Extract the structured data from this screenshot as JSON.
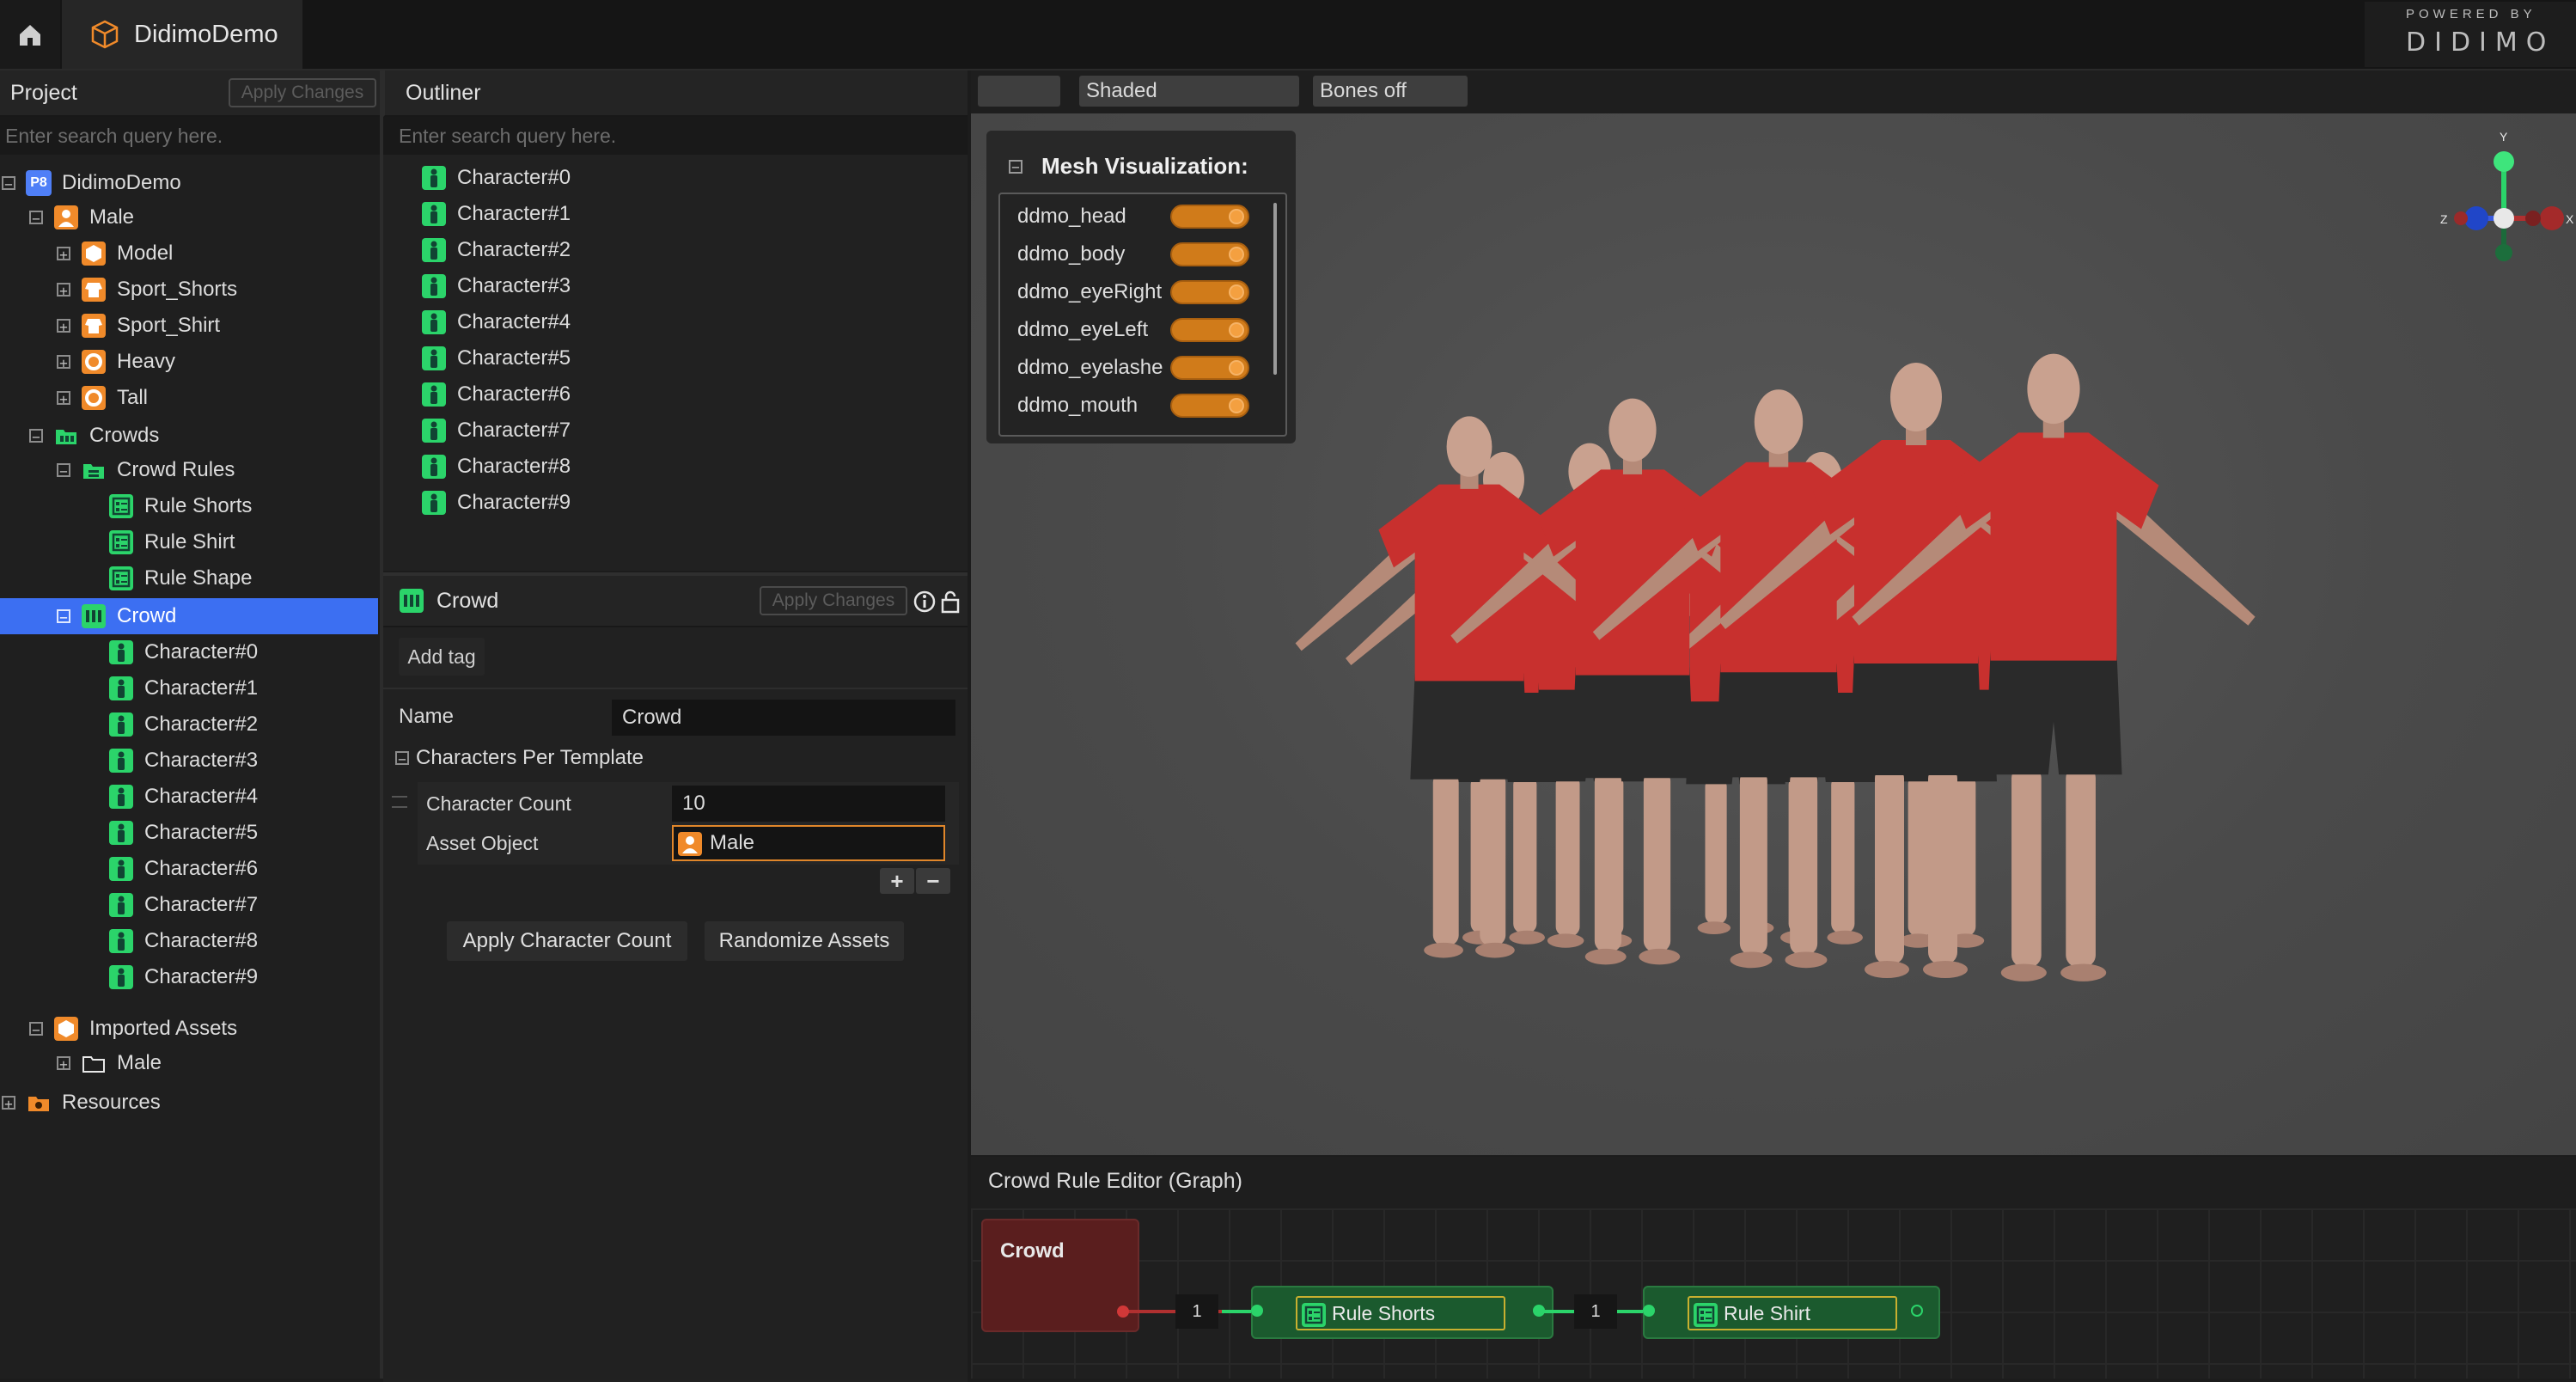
{
  "app": {
    "tab_title": "DidimoDemo",
    "powered_by": "POWERED BY",
    "brand": "DIDIMO"
  },
  "project": {
    "title": "Project",
    "apply_label": "Apply Changes",
    "search_placeholder": "Enter search query here.",
    "tree": {
      "root": "DidimoDemo",
      "root_badge": "P8",
      "male": "Male",
      "model": "Model",
      "sport_shorts": "Sport_Shorts",
      "sport_shirt": "Sport_Shirt",
      "heavy": "Heavy",
      "tall": "Tall",
      "crowds": "Crowds",
      "crowd_rules": "Crowd Rules",
      "rule_shorts": "Rule Shorts",
      "rule_shirt": "Rule Shirt",
      "rule_shape": "Rule Shape",
      "crowd": "Crowd",
      "characters": [
        "Character#0",
        "Character#1",
        "Character#2",
        "Character#3",
        "Character#4",
        "Character#5",
        "Character#6",
        "Character#7",
        "Character#8",
        "Character#9"
      ],
      "imported_assets": "Imported Assets",
      "imported_male": "Male",
      "resources": "Resources"
    }
  },
  "outliner": {
    "title": "Outliner",
    "search_placeholder": "Enter search query here.",
    "items": [
      "Character#0",
      "Character#1",
      "Character#2",
      "Character#3",
      "Character#4",
      "Character#5",
      "Character#6",
      "Character#7",
      "Character#8",
      "Character#9"
    ]
  },
  "properties": {
    "title": "Crowd",
    "apply_label": "Apply Changes",
    "add_tag": "Add tag",
    "name_label": "Name",
    "name_value": "Crowd",
    "section": "Characters Per Template",
    "count_label": "Character Count",
    "count_value": "10",
    "asset_label": "Asset Object",
    "asset_value": "Male",
    "apply_count": "Apply Character Count",
    "randomize": "Randomize Assets"
  },
  "viewport": {
    "shading": "Shaded",
    "bones": "Bones off",
    "mesh_panel_title": "Mesh Visualization:",
    "meshes": [
      "ddmo_head",
      "ddmo_body",
      "ddmo_eyeRight",
      "ddmo_eyeLeft",
      "ddmo_eyelashes",
      "ddmo_mouth"
    ],
    "gizmo": {
      "y": "Y",
      "z": "Z",
      "x": "X"
    }
  },
  "graph": {
    "title": "Crowd Rule Editor (Graph)",
    "crowd_node": "Crowd",
    "link1": "1",
    "rule1": "Rule Shorts",
    "link2": "1",
    "rule2": "Rule Shirt"
  },
  "colors": {
    "selection": "#3c6ff2",
    "accent_orange": "#d07b1a",
    "accent_green": "#2bd46a",
    "shirt_red": "#c8302e"
  }
}
